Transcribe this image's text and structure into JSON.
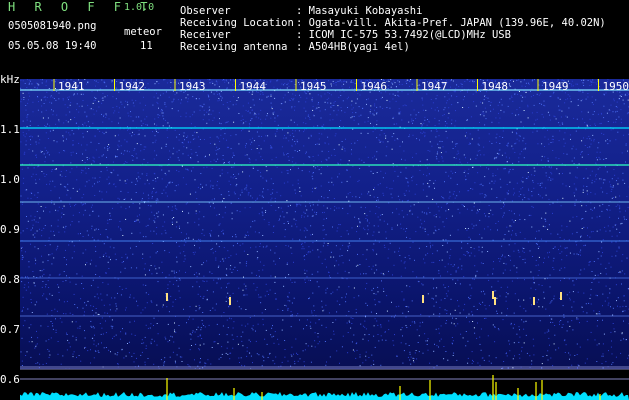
{
  "header": {
    "title": "H R O F F T",
    "version": "1.0.0",
    "filename": "0505081940.png",
    "meteor_label": "meteor",
    "datetime": "05.05.08 19:40",
    "meteor_count": "11"
  },
  "info": [
    {
      "label": "Observer",
      "value": ": Masayuki Kobayashi"
    },
    {
      "label": "Receiving Location",
      "value": ": Ogata-vill. Akita-Pref. JAPAN (139.96E, 40.02N)"
    },
    {
      "label": "Receiver",
      "value": ": ICOM IC-575 53.7492(@LCD)MHz USB"
    },
    {
      "label": "Receiving antenna",
      "value": ": A504HB(yagi 4el)"
    }
  ],
  "axis": {
    "y_unit": "kHz",
    "y_ticks": [
      "1.1",
      "1.0",
      "0.9",
      "0.8",
      "0.7",
      "0.6"
    ],
    "x_ticks": [
      "1941",
      "1942",
      "1943",
      "1944",
      "1945",
      "1946",
      "1947",
      "1948",
      "1949",
      "1950"
    ]
  },
  "colors": {
    "background": "#0a0a5a",
    "accent": "#00ffff",
    "tick": "#ffff00",
    "title": "#7fe07f"
  }
}
